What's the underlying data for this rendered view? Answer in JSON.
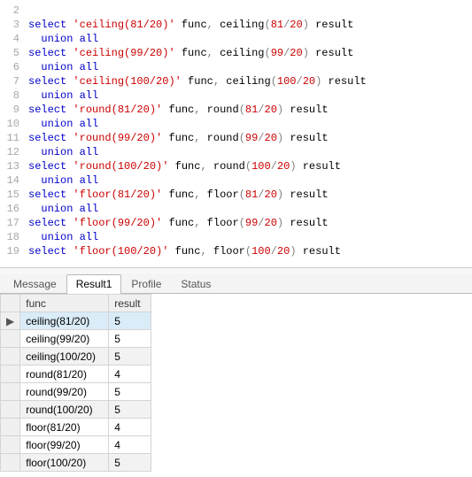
{
  "editor": {
    "lines": [
      {
        "n": 2,
        "tokens": []
      },
      {
        "n": 3,
        "tokens": [
          {
            "t": "kw",
            "v": "select"
          },
          {
            "t": "sp"
          },
          {
            "t": "str",
            "v": "'ceiling(81/20)'"
          },
          {
            "t": "sp"
          },
          {
            "t": "ident",
            "v": "func"
          },
          {
            "t": "punc",
            "v": ","
          },
          {
            "t": "sp"
          },
          {
            "t": "ident",
            "v": "ceiling"
          },
          {
            "t": "punc",
            "v": "("
          },
          {
            "t": "num",
            "v": "81"
          },
          {
            "t": "op",
            "v": "/"
          },
          {
            "t": "num",
            "v": "20"
          },
          {
            "t": "punc",
            "v": ")"
          },
          {
            "t": "sp"
          },
          {
            "t": "ident",
            "v": "result"
          }
        ]
      },
      {
        "n": 4,
        "tokens": [
          {
            "t": "indent"
          },
          {
            "t": "kw",
            "v": "union"
          },
          {
            "t": "sp"
          },
          {
            "t": "kw",
            "v": "all"
          }
        ]
      },
      {
        "n": 5,
        "tokens": [
          {
            "t": "kw",
            "v": "select"
          },
          {
            "t": "sp"
          },
          {
            "t": "str",
            "v": "'ceiling(99/20)'"
          },
          {
            "t": "sp"
          },
          {
            "t": "ident",
            "v": "func"
          },
          {
            "t": "punc",
            "v": ","
          },
          {
            "t": "sp"
          },
          {
            "t": "ident",
            "v": "ceiling"
          },
          {
            "t": "punc",
            "v": "("
          },
          {
            "t": "num",
            "v": "99"
          },
          {
            "t": "op",
            "v": "/"
          },
          {
            "t": "num",
            "v": "20"
          },
          {
            "t": "punc",
            "v": ")"
          },
          {
            "t": "sp"
          },
          {
            "t": "ident",
            "v": "result"
          }
        ]
      },
      {
        "n": 6,
        "tokens": [
          {
            "t": "indent"
          },
          {
            "t": "kw",
            "v": "union"
          },
          {
            "t": "sp"
          },
          {
            "t": "kw",
            "v": "all"
          }
        ]
      },
      {
        "n": 7,
        "tokens": [
          {
            "t": "kw",
            "v": "select"
          },
          {
            "t": "sp"
          },
          {
            "t": "str",
            "v": "'ceiling(100/20)'"
          },
          {
            "t": "sp"
          },
          {
            "t": "ident",
            "v": "func"
          },
          {
            "t": "punc",
            "v": ","
          },
          {
            "t": "sp"
          },
          {
            "t": "ident",
            "v": "ceiling"
          },
          {
            "t": "punc",
            "v": "("
          },
          {
            "t": "num",
            "v": "100"
          },
          {
            "t": "op",
            "v": "/"
          },
          {
            "t": "num",
            "v": "20"
          },
          {
            "t": "punc",
            "v": ")"
          },
          {
            "t": "sp"
          },
          {
            "t": "ident",
            "v": "result"
          }
        ]
      },
      {
        "n": 8,
        "tokens": [
          {
            "t": "indent"
          },
          {
            "t": "kw",
            "v": "union"
          },
          {
            "t": "sp"
          },
          {
            "t": "kw",
            "v": "all"
          }
        ]
      },
      {
        "n": 9,
        "tokens": [
          {
            "t": "kw",
            "v": "select"
          },
          {
            "t": "sp"
          },
          {
            "t": "str",
            "v": "'round(81/20)'"
          },
          {
            "t": "sp"
          },
          {
            "t": "ident",
            "v": "func"
          },
          {
            "t": "punc",
            "v": ","
          },
          {
            "t": "sp"
          },
          {
            "t": "ident",
            "v": "round"
          },
          {
            "t": "punc",
            "v": "("
          },
          {
            "t": "num",
            "v": "81"
          },
          {
            "t": "op",
            "v": "/"
          },
          {
            "t": "num",
            "v": "20"
          },
          {
            "t": "punc",
            "v": ")"
          },
          {
            "t": "sp"
          },
          {
            "t": "ident",
            "v": "result"
          }
        ]
      },
      {
        "n": 10,
        "tokens": [
          {
            "t": "indent"
          },
          {
            "t": "kw",
            "v": "union"
          },
          {
            "t": "sp"
          },
          {
            "t": "kw",
            "v": "all"
          }
        ]
      },
      {
        "n": 11,
        "tokens": [
          {
            "t": "kw",
            "v": "select"
          },
          {
            "t": "sp"
          },
          {
            "t": "str",
            "v": "'round(99/20)'"
          },
          {
            "t": "sp"
          },
          {
            "t": "ident",
            "v": "func"
          },
          {
            "t": "punc",
            "v": ","
          },
          {
            "t": "sp"
          },
          {
            "t": "ident",
            "v": "round"
          },
          {
            "t": "punc",
            "v": "("
          },
          {
            "t": "num",
            "v": "99"
          },
          {
            "t": "op",
            "v": "/"
          },
          {
            "t": "num",
            "v": "20"
          },
          {
            "t": "punc",
            "v": ")"
          },
          {
            "t": "sp"
          },
          {
            "t": "ident",
            "v": "result"
          }
        ]
      },
      {
        "n": 12,
        "tokens": [
          {
            "t": "indent"
          },
          {
            "t": "kw",
            "v": "union"
          },
          {
            "t": "sp"
          },
          {
            "t": "kw",
            "v": "all"
          }
        ]
      },
      {
        "n": 13,
        "tokens": [
          {
            "t": "kw",
            "v": "select"
          },
          {
            "t": "sp"
          },
          {
            "t": "str",
            "v": "'round(100/20)'"
          },
          {
            "t": "sp"
          },
          {
            "t": "ident",
            "v": "func"
          },
          {
            "t": "punc",
            "v": ","
          },
          {
            "t": "sp"
          },
          {
            "t": "ident",
            "v": "round"
          },
          {
            "t": "punc",
            "v": "("
          },
          {
            "t": "num",
            "v": "100"
          },
          {
            "t": "op",
            "v": "/"
          },
          {
            "t": "num",
            "v": "20"
          },
          {
            "t": "punc",
            "v": ")"
          },
          {
            "t": "sp"
          },
          {
            "t": "ident",
            "v": "result"
          }
        ]
      },
      {
        "n": 14,
        "tokens": [
          {
            "t": "indent"
          },
          {
            "t": "kw",
            "v": "union"
          },
          {
            "t": "sp"
          },
          {
            "t": "kw",
            "v": "all"
          }
        ]
      },
      {
        "n": 15,
        "tokens": [
          {
            "t": "kw",
            "v": "select"
          },
          {
            "t": "sp"
          },
          {
            "t": "str",
            "v": "'floor(81/20)'"
          },
          {
            "t": "sp"
          },
          {
            "t": "ident",
            "v": "func"
          },
          {
            "t": "punc",
            "v": ","
          },
          {
            "t": "sp"
          },
          {
            "t": "ident",
            "v": "floor"
          },
          {
            "t": "punc",
            "v": "("
          },
          {
            "t": "num",
            "v": "81"
          },
          {
            "t": "op",
            "v": "/"
          },
          {
            "t": "num",
            "v": "20"
          },
          {
            "t": "punc",
            "v": ")"
          },
          {
            "t": "sp"
          },
          {
            "t": "ident",
            "v": "result"
          }
        ]
      },
      {
        "n": 16,
        "tokens": [
          {
            "t": "indent"
          },
          {
            "t": "kw",
            "v": "union"
          },
          {
            "t": "sp"
          },
          {
            "t": "kw",
            "v": "all"
          }
        ]
      },
      {
        "n": 17,
        "tokens": [
          {
            "t": "kw",
            "v": "select"
          },
          {
            "t": "sp"
          },
          {
            "t": "str",
            "v": "'floor(99/20)'"
          },
          {
            "t": "sp"
          },
          {
            "t": "ident",
            "v": "func"
          },
          {
            "t": "punc",
            "v": ","
          },
          {
            "t": "sp"
          },
          {
            "t": "ident",
            "v": "floor"
          },
          {
            "t": "punc",
            "v": "("
          },
          {
            "t": "num",
            "v": "99"
          },
          {
            "t": "op",
            "v": "/"
          },
          {
            "t": "num",
            "v": "20"
          },
          {
            "t": "punc",
            "v": ")"
          },
          {
            "t": "sp"
          },
          {
            "t": "ident",
            "v": "result"
          }
        ]
      },
      {
        "n": 18,
        "tokens": [
          {
            "t": "indent"
          },
          {
            "t": "kw",
            "v": "union"
          },
          {
            "t": "sp"
          },
          {
            "t": "kw",
            "v": "all"
          }
        ]
      },
      {
        "n": 19,
        "tokens": [
          {
            "t": "kw",
            "v": "select"
          },
          {
            "t": "sp"
          },
          {
            "t": "str",
            "v": "'floor(100/20)'"
          },
          {
            "t": "sp"
          },
          {
            "t": "ident",
            "v": "func"
          },
          {
            "t": "punc",
            "v": ","
          },
          {
            "t": "sp"
          },
          {
            "t": "ident",
            "v": "floor"
          },
          {
            "t": "punc",
            "v": "("
          },
          {
            "t": "num",
            "v": "100"
          },
          {
            "t": "op",
            "v": "/"
          },
          {
            "t": "num",
            "v": "20"
          },
          {
            "t": "punc",
            "v": ")"
          },
          {
            "t": "sp"
          },
          {
            "t": "ident",
            "v": "result"
          }
        ]
      }
    ]
  },
  "tabs": {
    "items": [
      "Message",
      "Result1",
      "Profile",
      "Status"
    ],
    "active_index": 1
  },
  "grid": {
    "columns": [
      "func",
      "result"
    ],
    "current_row_marker": "▶",
    "current_row_index": 0,
    "alt_rows": [
      2,
      5,
      8
    ],
    "rows": [
      {
        "func": "ceiling(81/20)",
        "result": "5"
      },
      {
        "func": "ceiling(99/20)",
        "result": "5"
      },
      {
        "func": "ceiling(100/20)",
        "result": "5"
      },
      {
        "func": "round(81/20)",
        "result": "4"
      },
      {
        "func": "round(99/20)",
        "result": "5"
      },
      {
        "func": "round(100/20)",
        "result": "5"
      },
      {
        "func": "floor(81/20)",
        "result": "4"
      },
      {
        "func": "floor(99/20)",
        "result": "4"
      },
      {
        "func": "floor(100/20)",
        "result": "5"
      }
    ]
  }
}
